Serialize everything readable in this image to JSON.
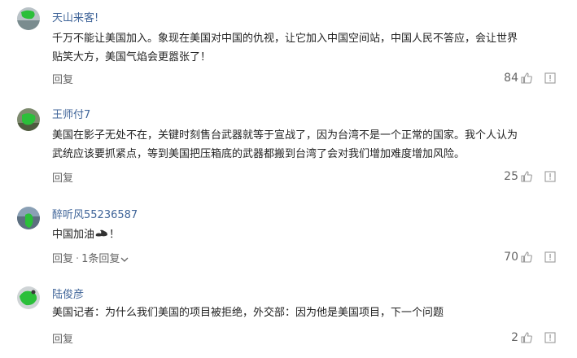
{
  "comments": [
    {
      "username": "天山来客!",
      "lines": [
        "千万不能让美国加入。象现在美国对中国的仇视，让它加入中国空间站，中国人民不答应，会让世界",
        "贴笑大方，美国气焰会更嚣张了！"
      ],
      "reply_label": "回复",
      "likes": "84"
    },
    {
      "username": "王师付7",
      "lines": [
        "美国在影子无处不在，关键时刻售台武器就等于宣战了，因为台湾不是一个正常的国家。我个人认为",
        "武统应该要抓紧点，等到美国把压箱底的武器都搬到台湾了会对我们增加难度增加风险。"
      ],
      "reply_label": "回复",
      "likes": "25"
    },
    {
      "username": "醉听风55236587",
      "text_before_emoji": "中国加油",
      "text_after_emoji": "！",
      "emoji": "flexed-biceps-emoji",
      "reply_label": "回复",
      "separator": "·",
      "replies_link": "1条回复",
      "likes": "70"
    },
    {
      "username": "陆俊彦",
      "lines": [
        "美国记者：为什么我们美国的项目被拒绝，外交部：因为他是美国项目，下一个问题"
      ],
      "reply_label": "回复",
      "likes": "2"
    }
  ],
  "colors": {
    "username": "#406599",
    "text": "#222222",
    "muted": "#666666",
    "avatar_green": "#2bbf3a"
  },
  "icons": {
    "like": "thumb-up-icon",
    "report": "report-icon",
    "expand": "chevron-down-icon"
  }
}
